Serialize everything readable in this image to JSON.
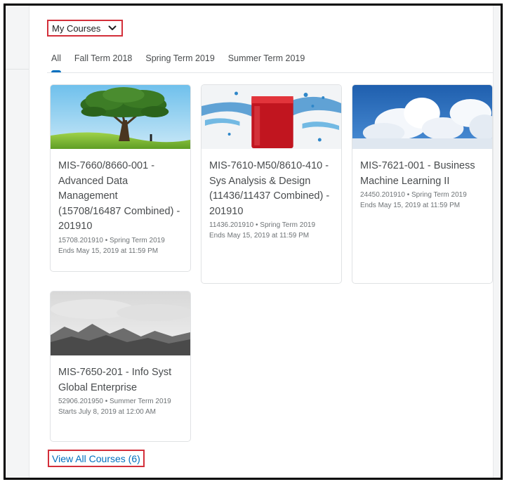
{
  "selector": {
    "label": "My Courses",
    "icon": "chevron-down-icon"
  },
  "tabs": [
    {
      "label": "All",
      "active": true
    },
    {
      "label": "Fall Term 2018",
      "active": false
    },
    {
      "label": "Spring Term 2019",
      "active": false
    },
    {
      "label": "Summer Term 2019",
      "active": false
    }
  ],
  "courses": [
    {
      "image": "tree-on-hill",
      "title": "MIS-7660/8660-001 - Advanced Data Management (15708/16487 Combined) - 201910",
      "meta": "15708.201910 • Spring Term 2019",
      "ends": "Ends May 15, 2019 at 11:59 PM"
    },
    {
      "image": "red-liquid-splash",
      "title": "MIS-7610-M50/8610-410 - Sys Analysis & Design (11436/11437 Combined) - 201910",
      "meta": "11436.201910 • Spring Term 2019",
      "ends": "Ends May 15, 2019 at 11:59 PM"
    },
    {
      "image": "clouds-blue-sky",
      "title": "MIS-7621-001 - Business Machine Learning II",
      "meta": "24450.201910 • Spring Term 2019",
      "ends": "Ends May 15, 2019 at 11:59 PM"
    },
    {
      "image": "misty-mountains",
      "title": "MIS-7650-201 - Info Syst Global Enterprise",
      "meta": "52906.201950 • Summer Term 2019",
      "ends": "Starts July 8, 2019 at 12:00 AM"
    }
  ],
  "view_all": {
    "label": "View All Courses (6)"
  },
  "colors": {
    "accent": "#006fbf",
    "highlight_border": "#d32f3a",
    "text": "#494c4e",
    "muted": "#6e7376"
  }
}
